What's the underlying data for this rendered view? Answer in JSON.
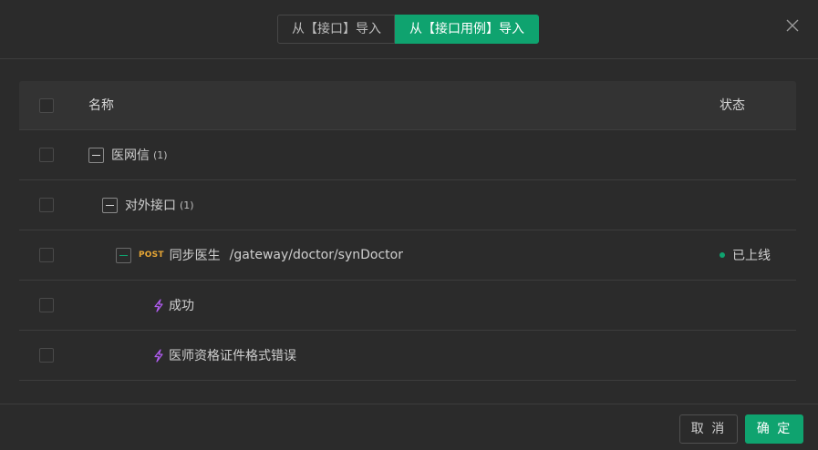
{
  "header": {
    "tabs": [
      {
        "label": "从【接口】导入"
      },
      {
        "label": "从【接口用例】导入"
      }
    ],
    "close_icon": "close-icon"
  },
  "table": {
    "col_name": "名称",
    "col_status": "状态",
    "rows": [
      {
        "name": "医网信",
        "count": "(1)",
        "type": "group"
      },
      {
        "name": "对外接口",
        "count": "(1)",
        "type": "group"
      },
      {
        "method": "POST",
        "name": "同步医生",
        "path": "/gateway/doctor/synDoctor",
        "status": "已上线",
        "type": "api"
      },
      {
        "name": "成功",
        "type": "case",
        "icon": "bolt-icon"
      },
      {
        "name": "医师资格证件格式错误",
        "type": "case",
        "icon": "bolt-icon"
      }
    ]
  },
  "footer": {
    "cancel_label": "取 消",
    "ok_label": "确 定"
  },
  "colors": {
    "accent": "#0fa36f",
    "method_post": "#e8a735",
    "case_icon": "#b05cf0"
  }
}
